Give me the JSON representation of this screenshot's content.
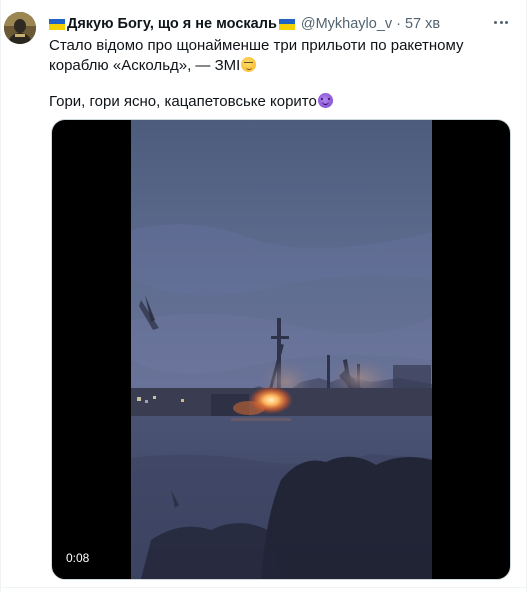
{
  "tweet": {
    "author": {
      "flag_icon": "ukraine-flag-icon",
      "display_name": "Дякую Богу, що я не москаль",
      "handle": "@Mykhaylo_v",
      "separator": "·",
      "time": "57 хв"
    },
    "more_icon": "more-dots-icon",
    "text": {
      "line1": "Стало відомо про щонайменше три прильоти по ракетному кораблю «Аскольд», — ЗМІ",
      "line1_emoji": "smirking-face-icon",
      "line2": "Гори, гори ясно, кацапетовське корито",
      "line2_emoji": "smiling-devil-icon"
    },
    "media": {
      "type": "video",
      "duration": "0:08"
    }
  },
  "colors": {
    "text_primary": "#0f1419",
    "text_secondary": "#536471",
    "border": "#cfd9de",
    "flag_blue": "#1f63c9",
    "flag_yellow": "#f5d000"
  }
}
